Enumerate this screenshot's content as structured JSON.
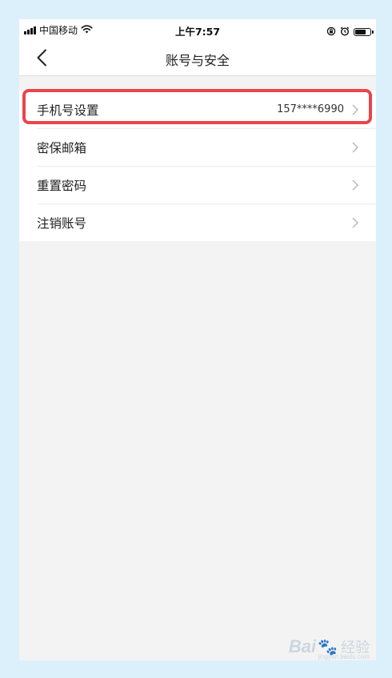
{
  "status_bar": {
    "carrier": "中国移动",
    "time": "上午7:57",
    "battery_level": 0.75
  },
  "nav": {
    "title": "账号与安全"
  },
  "settings": {
    "items": [
      {
        "label": "手机号设置",
        "value": "157****6990"
      },
      {
        "label": "密保邮箱",
        "value": ""
      },
      {
        "label": "重置密码",
        "value": ""
      },
      {
        "label": "注销账号",
        "value": ""
      }
    ]
  },
  "watermark": {
    "brand": "Bai",
    "suffix": "经验",
    "url": "jingyan.baidu.com"
  },
  "colors": {
    "highlight": "#e9454c",
    "background": "#f3f3f3",
    "outer_border": "#dcf0fb"
  }
}
